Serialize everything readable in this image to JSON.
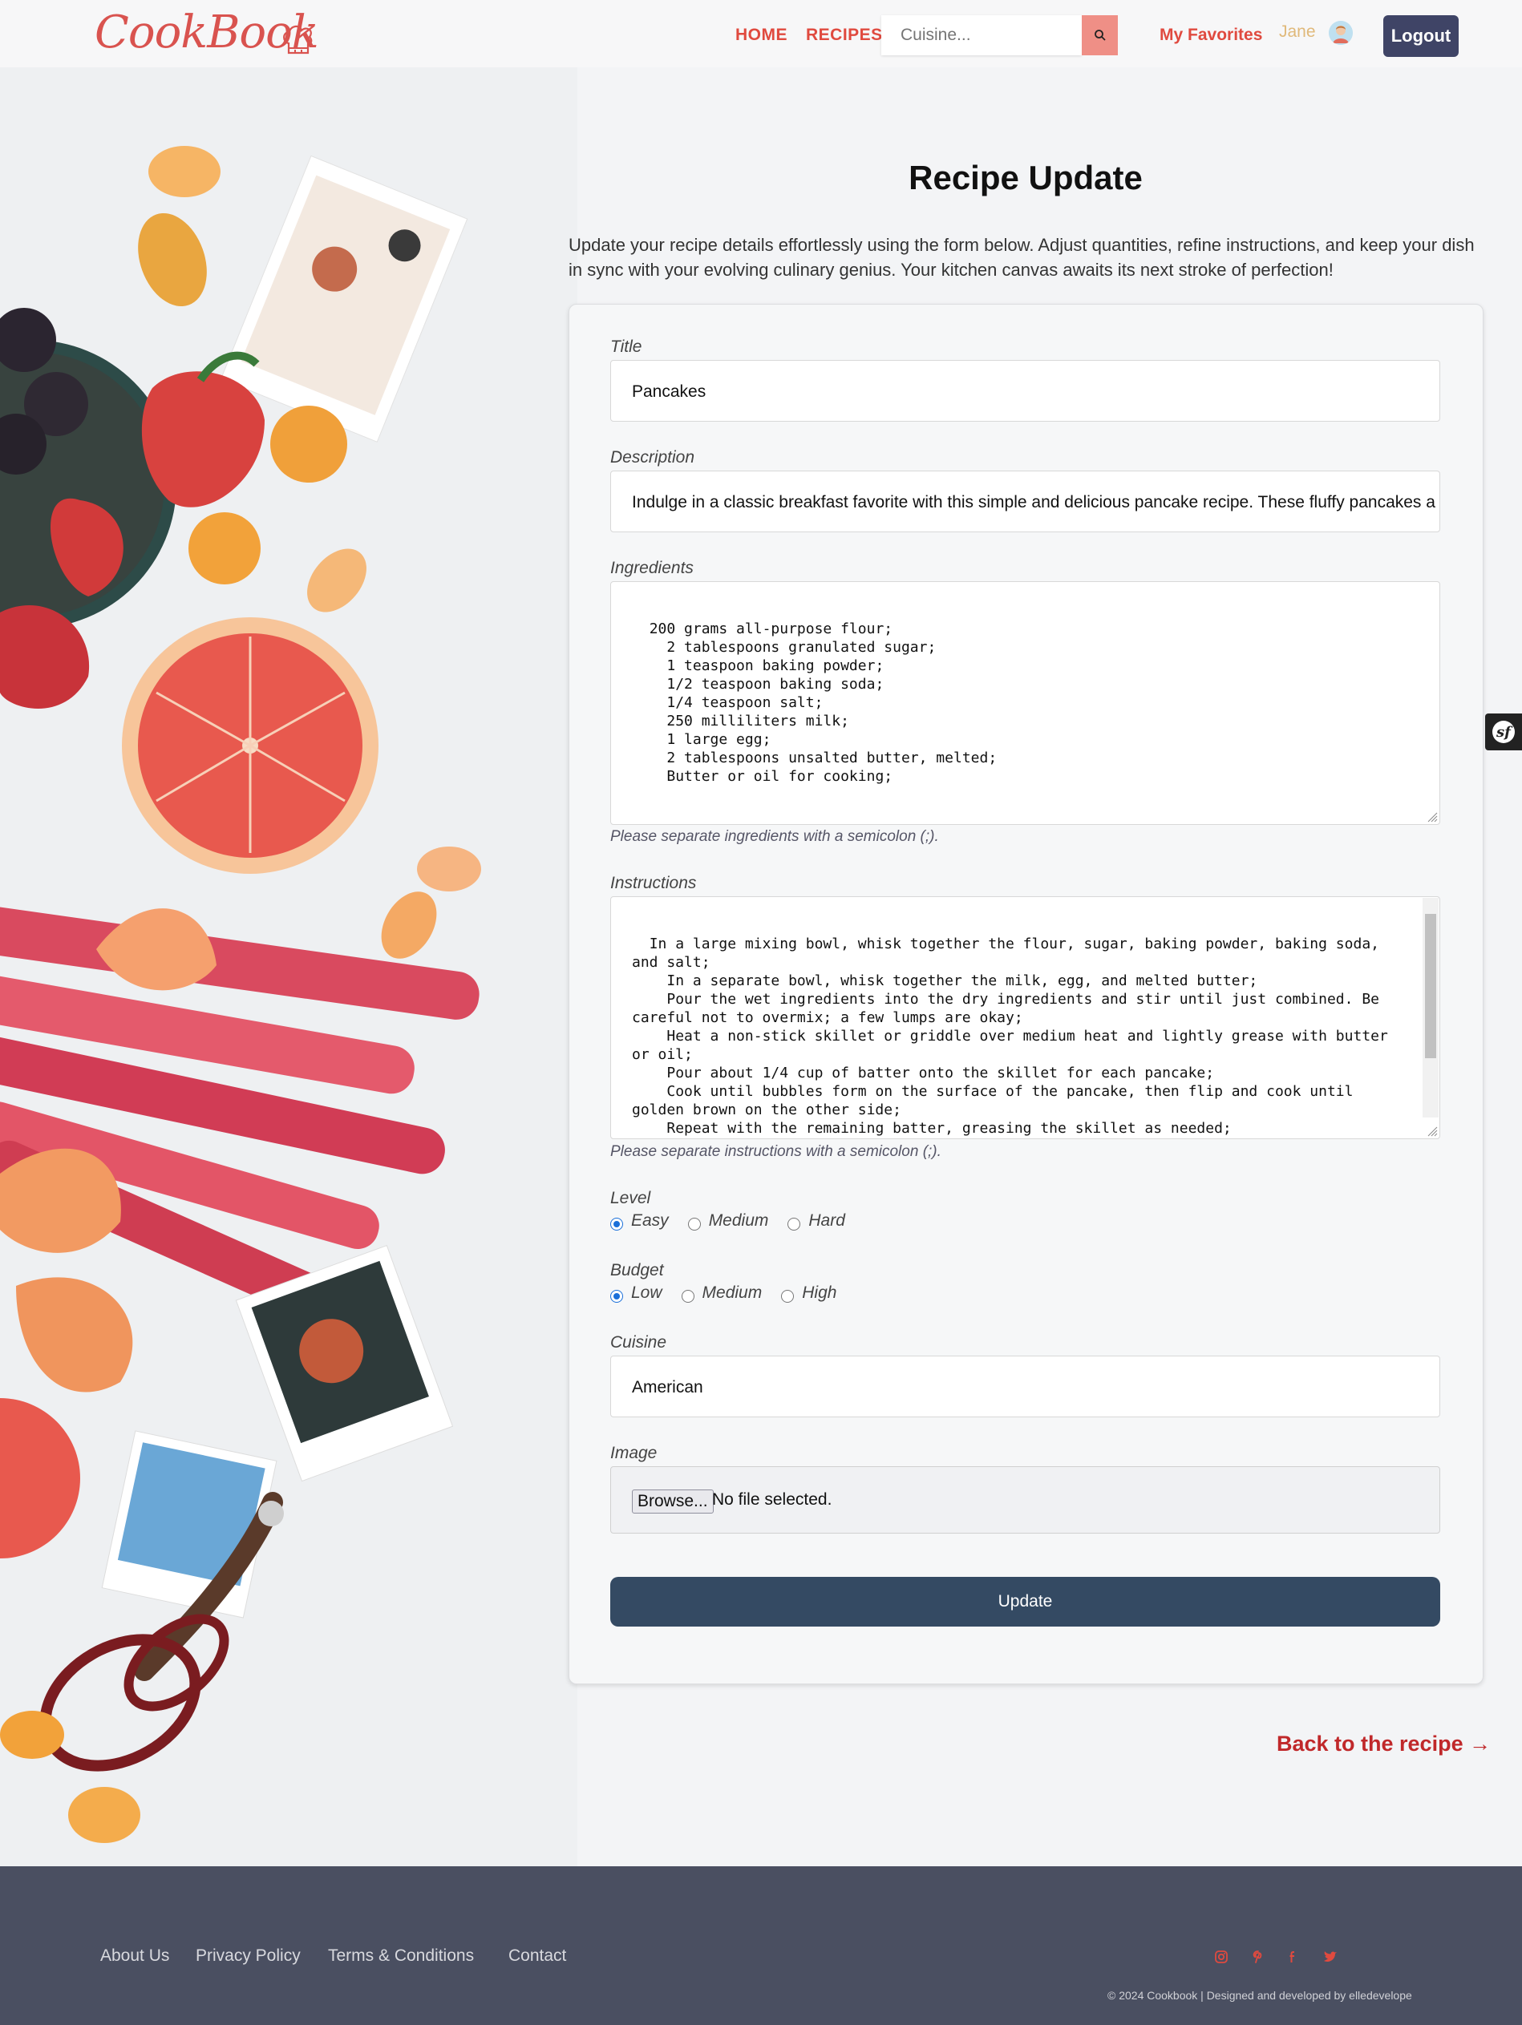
{
  "brand": {
    "name": "CookBook"
  },
  "nav": {
    "home": "HOME",
    "recipes": "RECIPES",
    "search_placeholder": "Cuisine...",
    "favorites": "My Favorites",
    "user": "Jane",
    "logout": "Logout"
  },
  "page": {
    "title": "Recipe Update",
    "intro": "Update your recipe details effortlessly using the form below. Adjust quantities, refine instructions, and keep your dish in sync with your evolving culinary genius. Your kitchen canvas awaits its next stroke of perfection!"
  },
  "form": {
    "title": {
      "label": "Title",
      "value": "Pancakes"
    },
    "description": {
      "label": "Description",
      "value": "Indulge in a classic breakfast favorite with this simple and delicious pancake recipe. These fluffy pancakes a"
    },
    "ingredients": {
      "label": "Ingredients",
      "value": "200 grams all-purpose flour;\n    2 tablespoons granulated sugar;\n    1 teaspoon baking powder;\n    1/2 teaspoon baking soda;\n    1/4 teaspoon salt;\n    250 milliliters milk;\n    1 large egg;\n    2 tablespoons unsalted butter, melted;\n    Butter or oil for cooking;",
      "hint": "Please separate ingredients with a semicolon (;)."
    },
    "instructions": {
      "label": "Instructions",
      "value": "In a large mixing bowl, whisk together the flour, sugar, baking powder, baking soda, and salt;\n    In a separate bowl, whisk together the milk, egg, and melted butter;\n    Pour the wet ingredients into the dry ingredients and stir until just combined. Be careful not to overmix; a few lumps are okay;\n    Heat a non-stick skillet or griddle over medium heat and lightly grease with butter or oil;\n    Pour about 1/4 cup of batter onto the skillet for each pancake;\n    Cook until bubbles form on the surface of the pancake, then flip and cook until golden brown on the other side;\n    Repeat with the remaining batter, greasing the skillet as needed;\n    Serve the pancakes warm with your favorite toppings, such as maple syrup, fresh",
      "hint": "Please separate instructions with a semicolon (;)."
    },
    "level": {
      "label": "Level",
      "options": [
        "Easy",
        "Medium",
        "Hard"
      ],
      "selected": "Easy"
    },
    "budget": {
      "label": "Budget",
      "options": [
        "Low",
        "Medium",
        "High"
      ],
      "selected": "Low"
    },
    "cuisine": {
      "label": "Cuisine",
      "value": "American"
    },
    "image": {
      "label": "Image",
      "browse": "Browse...",
      "status": "No file selected."
    },
    "submit": "Update"
  },
  "back_link": "Back to the recipe →",
  "footer": {
    "links": [
      "About Us",
      "Privacy Policy",
      "Terms & Conditions",
      "Contact"
    ],
    "social": [
      "instagram-icon",
      "pinterest-icon",
      "facebook-icon",
      "twitter-icon"
    ],
    "copyright": "© 2024 Cookbook | Designed and developed by elledevelope"
  },
  "colors": {
    "accent": "#e04a3f",
    "logout_bg": "#3f4466",
    "submit_bg": "#344a63",
    "footer_bg": "#4a4f61",
    "back_link": "#c0282a"
  }
}
